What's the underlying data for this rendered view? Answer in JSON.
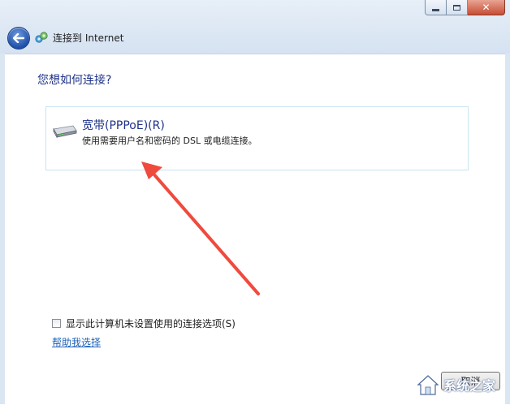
{
  "window": {
    "title": "连接到 Internet",
    "controls": {
      "minimize": "minimize",
      "maximize": "maximize",
      "close": "close"
    }
  },
  "page": {
    "heading": "您想如何连接?"
  },
  "option": {
    "title": "宽带(PPPoE)(R)",
    "description": "使用需要用户名和密码的 DSL 或电缆连接。",
    "icon": "broadband-modem-icon"
  },
  "annotation": {
    "arrow_color": "#f04a3e"
  },
  "footer": {
    "checkbox_label": "显示此计算机未设置使用的连接选项(S)",
    "checkbox_checked": false,
    "help_link": "帮助我选择",
    "cancel_button": "取消"
  },
  "watermark": {
    "text": "系统之家"
  },
  "colors": {
    "heading_blue": "#1e3287",
    "link_blue": "#1e63b8",
    "card_border": "#c7e5ef"
  }
}
